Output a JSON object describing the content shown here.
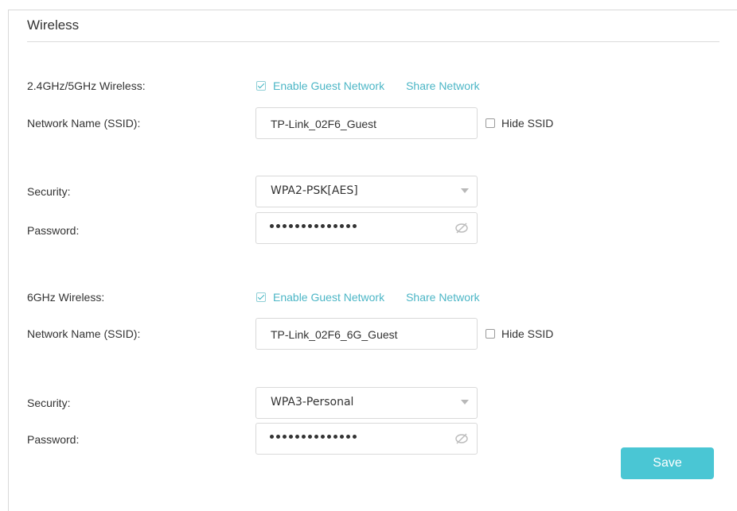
{
  "section": {
    "title": "Wireless"
  },
  "band1": {
    "label": "2.4GHz/5GHz Wireless:",
    "enable_label": "Enable Guest Network",
    "enable_checked": true,
    "share_label": "Share Network",
    "ssid_label": "Network Name (SSID):",
    "ssid_value": "TP-Link_02F6_Guest",
    "hide_ssid_label": "Hide SSID",
    "hide_ssid_checked": false,
    "security_label": "Security:",
    "security_value": "WPA2-PSK[AES]",
    "password_label": "Password:",
    "password_masked_length": 14
  },
  "band2": {
    "label": "6GHz Wireless:",
    "enable_label": "Enable Guest Network",
    "enable_checked": true,
    "share_label": "Share Network",
    "ssid_label": "Network Name (SSID):",
    "ssid_value": "TP-Link_02F6_6G_Guest",
    "hide_ssid_label": "Hide SSID",
    "hide_ssid_checked": false,
    "security_label": "Security:",
    "security_value": "WPA3-Personal",
    "password_label": "Password:",
    "password_masked_length": 14
  },
  "actions": {
    "save_label": "Save"
  },
  "icons": {
    "checkbox": "checkbox-icon",
    "eye_hidden": "eye-hidden-icon",
    "dropdown": "chevron-down-icon"
  },
  "colors": {
    "accent": "#4cb6c6",
    "save_button": "#4ac6d4",
    "border": "#d9d9d9"
  }
}
